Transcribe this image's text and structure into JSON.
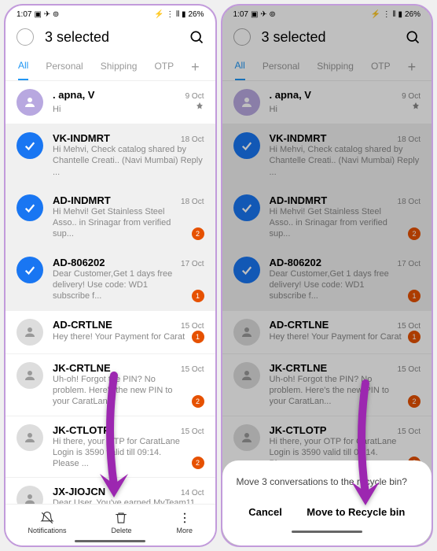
{
  "status": {
    "time": "1:07",
    "battery": "26%"
  },
  "header": {
    "title": "3 selected"
  },
  "tabs": {
    "all": "All",
    "personal": "Personal",
    "shipping": "Shipping",
    "otp": "OTP"
  },
  "messages": [
    {
      "sender": ". apna, V",
      "date": "9 Oct",
      "preview": "Hi",
      "avatar": "purple",
      "pin": true
    },
    {
      "sender": "VK-INDMRT",
      "date": "18 Oct",
      "preview": "Hi Mehvi, Check catalog shared by Chantelle Creati.. (Navi Mumbai)  Reply ...",
      "selected": true
    },
    {
      "sender": "AD-INDMRT",
      "date": "18 Oct",
      "preview": "Hi Mehvi! Get Stainless Steel Asso.. in Srinagar from verified sup...",
      "selected": true,
      "badge": "2"
    },
    {
      "sender": "AD-806202",
      "date": "17 Oct",
      "preview": "Dear Customer,Get 1 days free delivery! Use code: WD1 subscribe f...",
      "selected": true,
      "badge": "1"
    },
    {
      "sender": "AD-CRTLNE",
      "date": "15 Oct",
      "preview": "Hey there! Your Payment for Carat",
      "badge": "1"
    },
    {
      "sender": "JK-CRTLNE",
      "date": "15 Oct",
      "preview": "Uh-oh! Forgot the PIN? No problem. Here's the new PIN to your CaratLan...",
      "badge": "2"
    },
    {
      "sender": "JK-CTLOTP",
      "date": "15 Oct",
      "preview": "Hi there, your OTP for CaratLane Login is 3590 valid till 09:14. Please ...",
      "badge": "2"
    },
    {
      "sender": "JX-JIOJCN",
      "date": "14 Oct",
      "preview": "Dear User,  You've earned MyTeam11"
    }
  ],
  "bottom": {
    "notifications": "Notifications",
    "delete": "Delete",
    "more": "More"
  },
  "dialog": {
    "text": "Move 3 conversations to the recycle bin?",
    "cancel": "Cancel",
    "confirm": "Move to Recycle bin"
  }
}
